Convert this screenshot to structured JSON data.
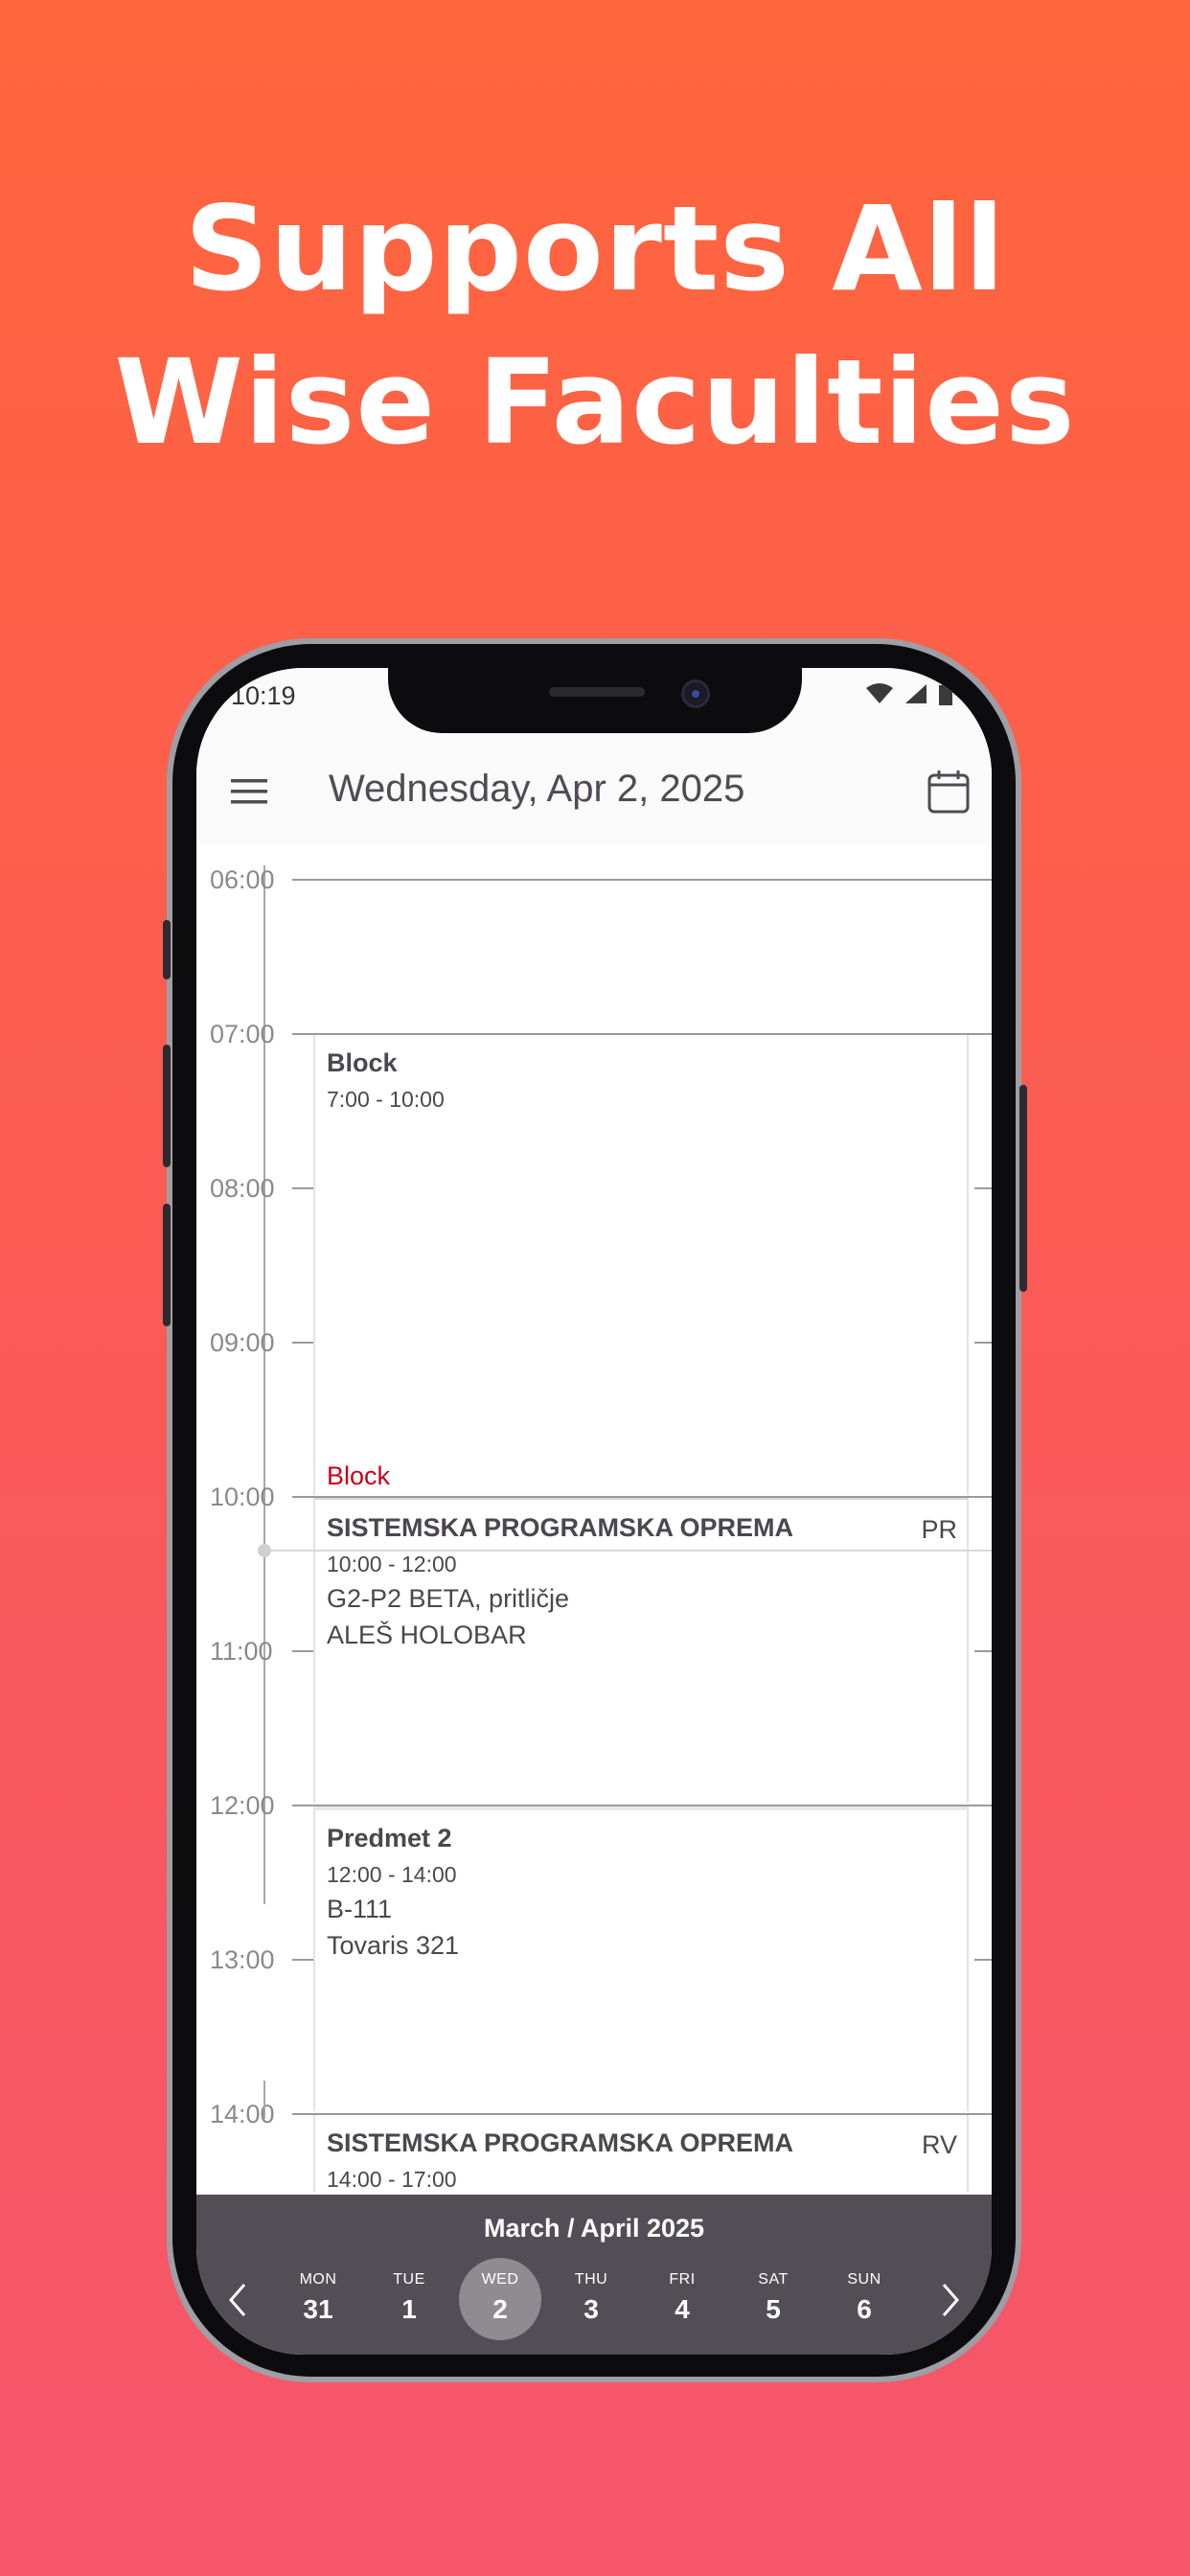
{
  "headline": {
    "line1": "Supports All",
    "line2": "Wise Faculties"
  },
  "status": {
    "time": "10:19"
  },
  "appbar": {
    "title": "Wednesday, Apr 2, 2025",
    "menu_icon": "hamburger-menu-icon",
    "calendar_icon": "calendar-icon"
  },
  "timeline": {
    "hours": [
      "06:00",
      "07:00",
      "08:00",
      "09:00",
      "10:00",
      "11:00",
      "12:00",
      "13:00",
      "14:00"
    ]
  },
  "events": [
    {
      "title": "Block",
      "time": "7:00 - 10:00",
      "footer": "Block"
    },
    {
      "title": "SISTEMSKA PROGRAMSKA OPREMA",
      "tag": "PR",
      "time": "10:00 - 12:00",
      "room": "G2-P2 BETA, pritličje",
      "teacher": "ALEŠ HOLOBAR"
    },
    {
      "title": "Predmet 2",
      "time": "12:00 - 14:00",
      "room": "B-111",
      "teacher": "Tovaris 321"
    },
    {
      "title": "SISTEMSKA PROGRAMSKA OPREMA",
      "tag": "RV",
      "time": "14:00 - 17:00"
    }
  ],
  "week": {
    "label": "March / April 2025",
    "days": [
      {
        "name": "MON",
        "num": "31"
      },
      {
        "name": "TUE",
        "num": "1"
      },
      {
        "name": "WED",
        "num": "2",
        "selected": true
      },
      {
        "name": "THU",
        "num": "3"
      },
      {
        "name": "FRI",
        "num": "4"
      },
      {
        "name": "SAT",
        "num": "5"
      },
      {
        "name": "SUN",
        "num": "6"
      }
    ]
  },
  "colors": {
    "accent_block": "#c8001c",
    "bottom_bar": "#534e55",
    "selected_day": "#8f8b90"
  }
}
